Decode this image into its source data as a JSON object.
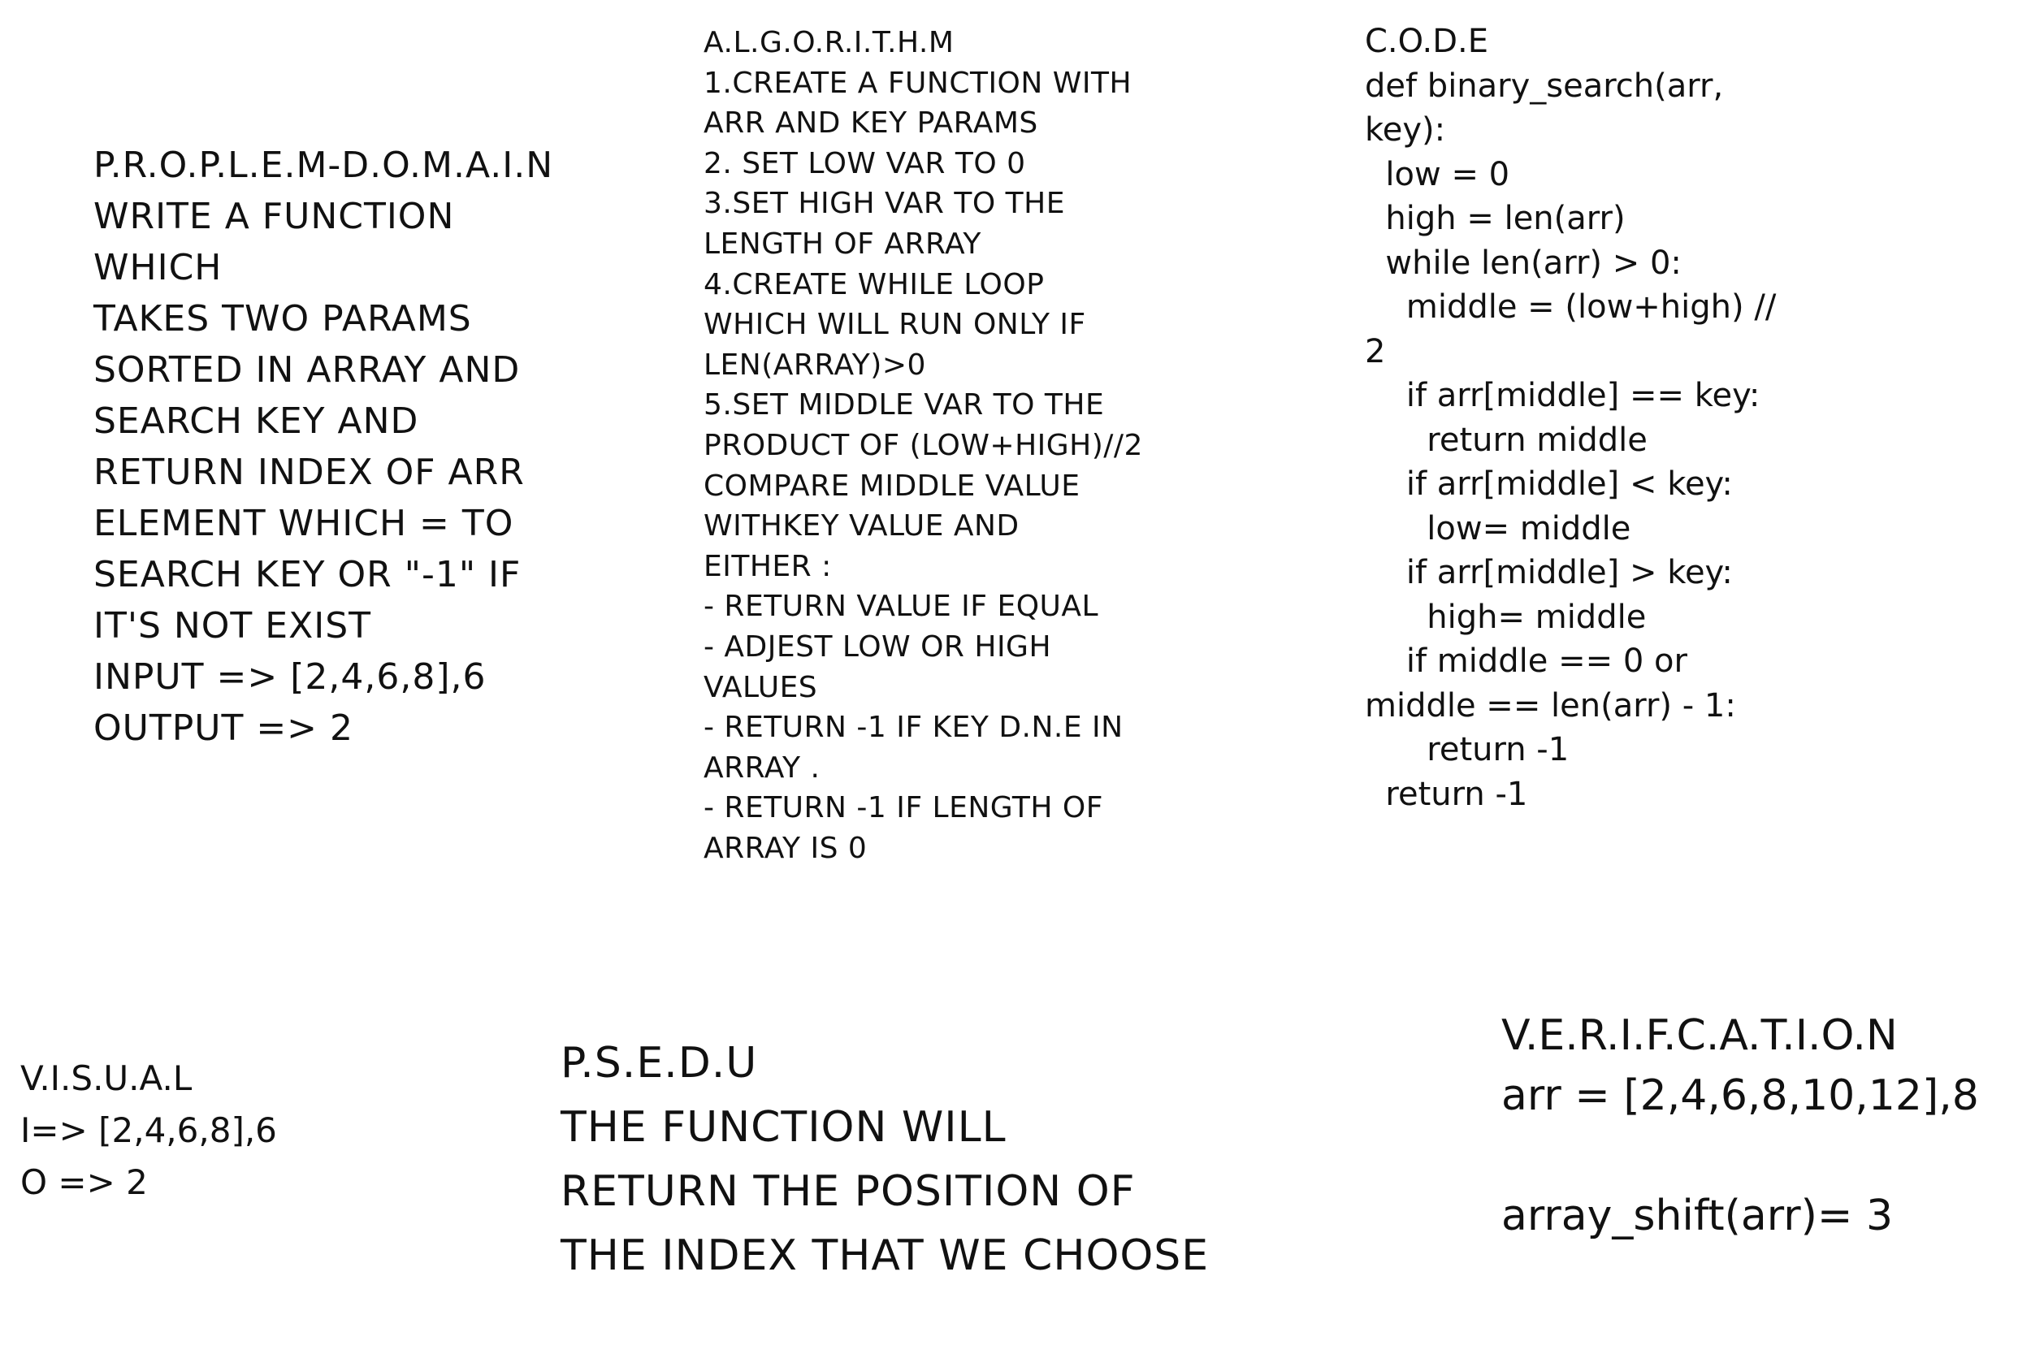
{
  "problem_domain": {
    "lines": [
      "P.R.O.P.L.E.M-D.O.M.A.I.N",
      "WRITE A FUNCTION",
      "WHICH",
      "TAKES TWO PARAMS",
      "SORTED IN ARRAY AND",
      "SEARCH KEY AND",
      "RETURN INDEX OF ARR",
      "ELEMENT WHICH = TO",
      "SEARCH KEY OR \"-1\" IF",
      "IT'S NOT EXIST",
      "INPUT => [2,4,6,8],6",
      "OUTPUT => 2"
    ]
  },
  "algorithm": {
    "lines": [
      "A.L.G.O.R.I.T.H.M",
      "1.CREATE A FUNCTION WITH",
      "ARR AND KEY PARAMS",
      "2. SET LOW VAR TO 0",
      "3.SET HIGH VAR TO THE",
      "LENGTH OF ARRAY",
      "4.CREATE WHILE LOOP",
      "WHICH WILL RUN ONLY IF",
      "LEN(ARRAY)>0",
      "5.SET MIDDLE VAR TO THE",
      "PRODUCT OF (LOW+HIGH)//2",
      "COMPARE MIDDLE VALUE",
      "WITHKEY VALUE AND",
      "EITHER :",
      "- RETURN VALUE IF EQUAL",
      "- ADJEST LOW OR HIGH",
      "VALUES",
      "- RETURN -1 IF KEY D.N.E IN",
      "ARRAY .",
      "- RETURN -1 IF LENGTH OF",
      "ARRAY IS 0"
    ]
  },
  "code": {
    "lines": [
      "C.O.D.E",
      "def binary_search(arr,",
      "key):",
      "  low = 0",
      "  high = len(arr)",
      "  while len(arr) > 0:",
      "    middle = (low+high) //",
      "2",
      "    if arr[middle] == key:",
      "      return middle",
      "    if arr[middle] < key:",
      "      low= middle",
      "    if arr[middle] > key:",
      "      high= middle",
      "    if middle == 0 or",
      "middle == len(arr) - 1:",
      "      return -1",
      "  return -1"
    ]
  },
  "visual": {
    "lines": [
      "V.I.S.U.A.L",
      "I=> [2,4,6,8],6",
      "O => 2"
    ]
  },
  "pseudo": {
    "lines": [
      "P.S.E.D.U",
      "THE FUNCTION WILL",
      "RETURN THE POSITION OF",
      "THE INDEX THAT WE CHOOSE"
    ]
  },
  "verification": {
    "lines": [
      "V.E.R.I.F.C.A.T.I.O.N",
      "arr = [2,4,6,8,10,12],8",
      "",
      "array_shift(arr)= 3"
    ]
  }
}
